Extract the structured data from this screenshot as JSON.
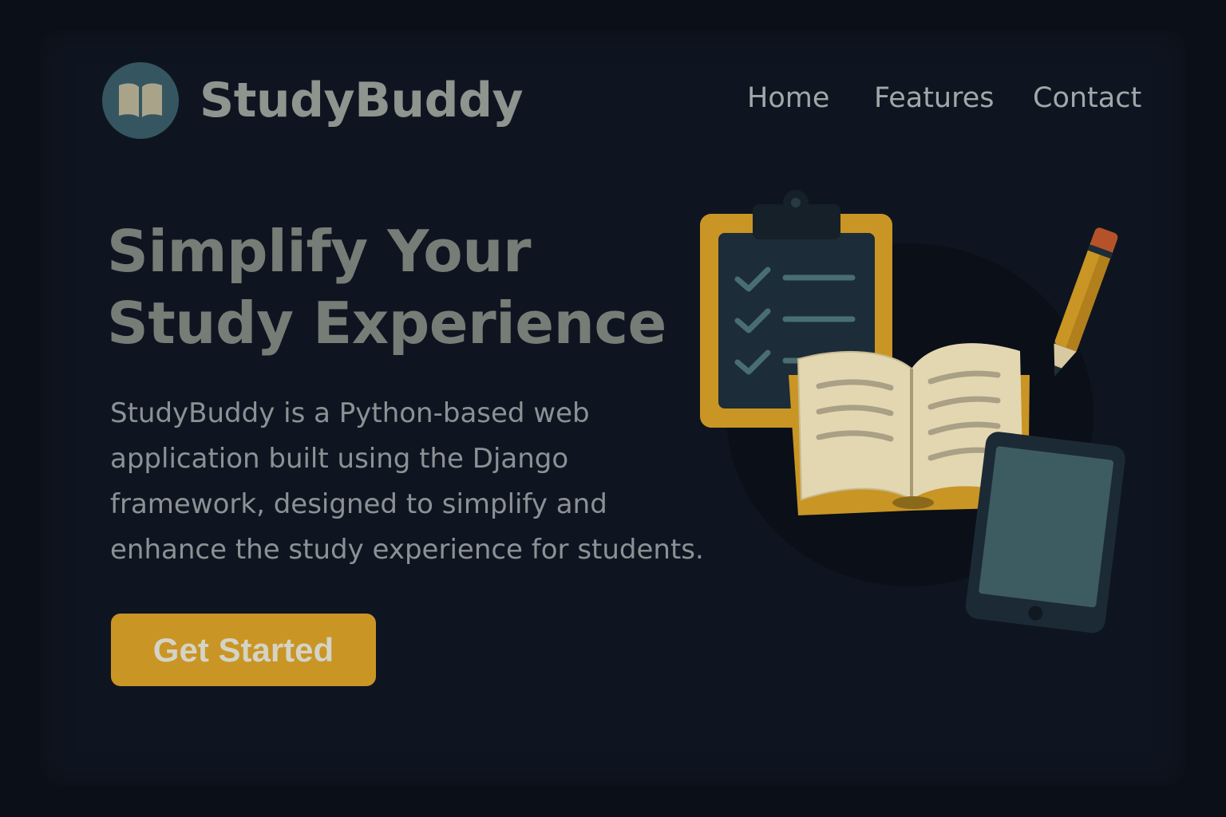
{
  "brand": {
    "name": "StudyBuddy",
    "logo_icon": "open-book-icon",
    "accent_color": "#c99524"
  },
  "nav": {
    "items": [
      {
        "label": "Home"
      },
      {
        "label": "Features"
      },
      {
        "label": "Contact"
      }
    ]
  },
  "hero": {
    "headline_line1": "Simplify Your",
    "headline_line2": "Study Experience",
    "description": "StudyBuddy is a Python-based web application built using the Django framework, designed to simplify and enhance the study experience for students.",
    "cta_label": "Get Started"
  },
  "illustration": {
    "icons": [
      "clipboard-checklist-icon",
      "open-book-icon",
      "pencil-icon",
      "tablet-icon"
    ]
  }
}
